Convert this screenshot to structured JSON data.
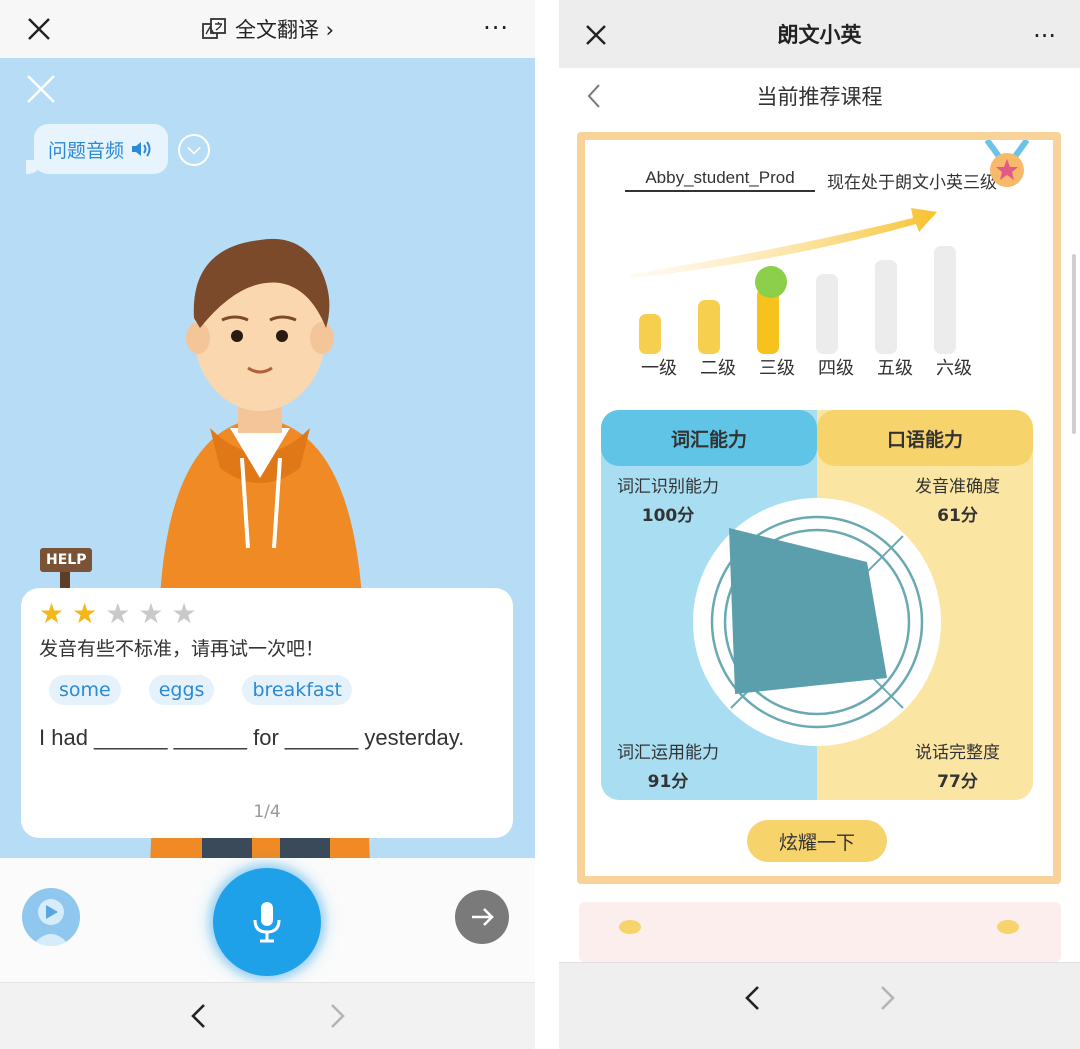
{
  "left": {
    "title": "全文翻译 ›",
    "more": "···",
    "audio_button": "问题音频",
    "help_sign": "HELP",
    "rating": {
      "stars": 2,
      "max": 5
    },
    "feedback": "发音有些不标准，请再试一次吧！",
    "choices": [
      "some",
      "eggs",
      "breakfast"
    ],
    "sentence": "I had ______ ______ for ______ yesterday.",
    "pager": "1/4"
  },
  "right": {
    "title": "朗文小英",
    "more": "···",
    "sub_title": "当前推荐课程",
    "username": "Abby_student_Prod",
    "level_desc": "现在处于朗文小英三级",
    "levels": [
      "一级",
      "二级",
      "三级",
      "四级",
      "五级",
      "六级"
    ],
    "current_level": 3,
    "vocab_header": "词汇能力",
    "oral_header": "口语能力",
    "metrics": {
      "recognition": {
        "label": "词汇识别能力",
        "value": "100分"
      },
      "pronunciation": {
        "label": "发音准确度",
        "value": "61分"
      },
      "usage": {
        "label": "词汇运用能力",
        "value": "91分"
      },
      "completeness": {
        "label": "说话完整度",
        "value": "77分"
      }
    },
    "share_button": "炫耀一下"
  },
  "colors": {
    "accent_blue": "#1fa1ea",
    "star": "#f5b718",
    "vocab_bg": "#a9def2",
    "oral_bg": "#fbe5a3",
    "radar_fill": "#5a9fab"
  }
}
